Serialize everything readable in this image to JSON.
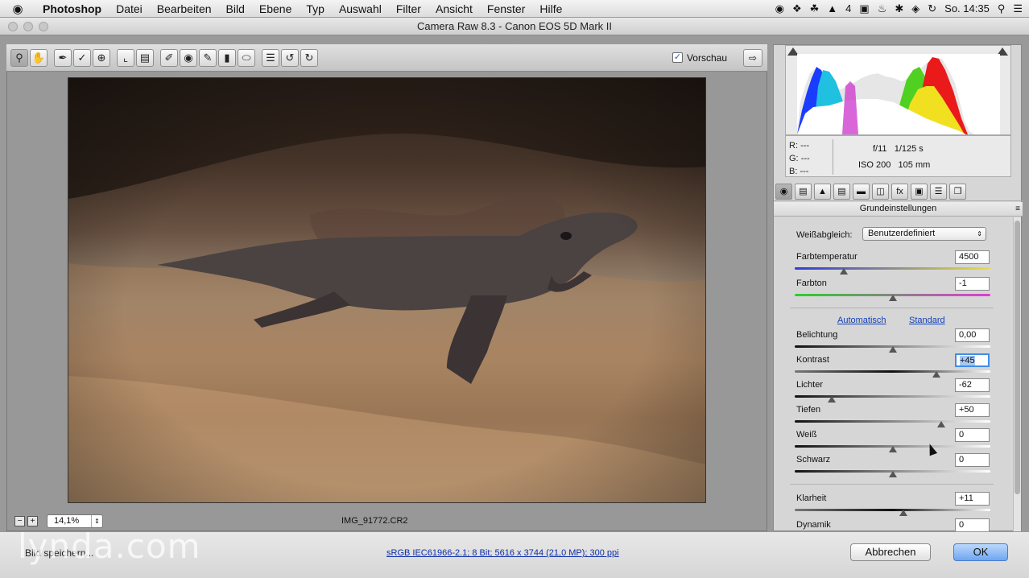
{
  "menubar": {
    "apple": "",
    "items": [
      "Photoshop",
      "Datei",
      "Bearbeiten",
      "Bild",
      "Ebene",
      "Typ",
      "Auswahl",
      "Filter",
      "Ansicht",
      "Fenster",
      "Hilfe"
    ],
    "status_a_count": "4",
    "clock": "So. 14:35"
  },
  "window": {
    "title": "Camera Raw 8.3 - Canon EOS 5D Mark II"
  },
  "toolbar": {
    "preview_label": "Vorschau",
    "preview_checked": "✓"
  },
  "image": {
    "filename": "IMG_91772.CR2",
    "zoom": "14,1%"
  },
  "histogram_info": {
    "r_label": "R:",
    "g_label": "G:",
    "b_label": "B:",
    "r_val": "---",
    "g_val": "---",
    "b_val": "---",
    "aperture": "f/11",
    "shutter": "1/125 s",
    "iso": "ISO 200",
    "focal": "105 mm"
  },
  "panel": {
    "title": "Grundeinstellungen",
    "wb_label": "Weißabgleich:",
    "wb_value": "Benutzerdefiniert",
    "auto_link": "Automatisch",
    "default_link": "Standard",
    "sliders": [
      {
        "label": "Farbtemperatur",
        "value": "4500",
        "pos": 0.25
      },
      {
        "label": "Farbton",
        "value": "-1",
        "pos": 0.5
      },
      {
        "label": "Belichtung",
        "value": "0,00",
        "pos": 0.5
      },
      {
        "label": "Kontrast",
        "value": "+45",
        "pos": 0.725
      },
      {
        "label": "Lichter",
        "value": "-62",
        "pos": 0.19
      },
      {
        "label": "Tiefen",
        "value": "+50",
        "pos": 0.75
      },
      {
        "label": "Weiß",
        "value": "0",
        "pos": 0.5
      },
      {
        "label": "Schwarz",
        "value": "0",
        "pos": 0.5
      },
      {
        "label": "Klarheit",
        "value": "+11",
        "pos": 0.555
      },
      {
        "label": "Dynamik",
        "value": "0",
        "pos": 0.5
      }
    ]
  },
  "footer": {
    "save_label": "Bild speichern...",
    "workflow": "sRGB IEC61966-2.1; 8 Bit; 5616 x 3744 (21,0 MP); 300 ppi",
    "cancel_label": "Abbrechen",
    "ok_label": "OK"
  },
  "watermark": "lynda.com",
  "colors": {
    "accent": "#3f8ee8",
    "ok_button": "#6ea6f0",
    "link": "#1240b8"
  }
}
